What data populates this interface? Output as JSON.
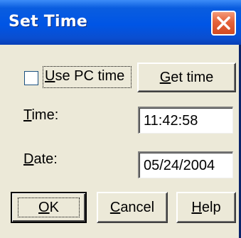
{
  "window": {
    "title": "Set Time",
    "title_bar_color": "#0055e5",
    "close_button_color": "#e5623a"
  },
  "options": {
    "use_pc_time": {
      "checked": false,
      "label_mnemonic": "U",
      "label_rest": "se PC time"
    },
    "get_time_button": {
      "mnemonic": "G",
      "rest": "et time"
    }
  },
  "fields": {
    "time": {
      "label_mnemonic": "T",
      "label_rest": "ime:",
      "value": "11:42:58"
    },
    "date": {
      "label_mnemonic": "D",
      "label_rest": "ate:",
      "value": "05/24/2004"
    }
  },
  "buttons": {
    "ok": {
      "mnemonic": "O",
      "rest": "K"
    },
    "cancel": {
      "mnemonic": "C",
      "rest": "ancel"
    },
    "help": {
      "mnemonic": "H",
      "rest": "elp"
    }
  },
  "icons": {
    "close": "close-icon"
  }
}
